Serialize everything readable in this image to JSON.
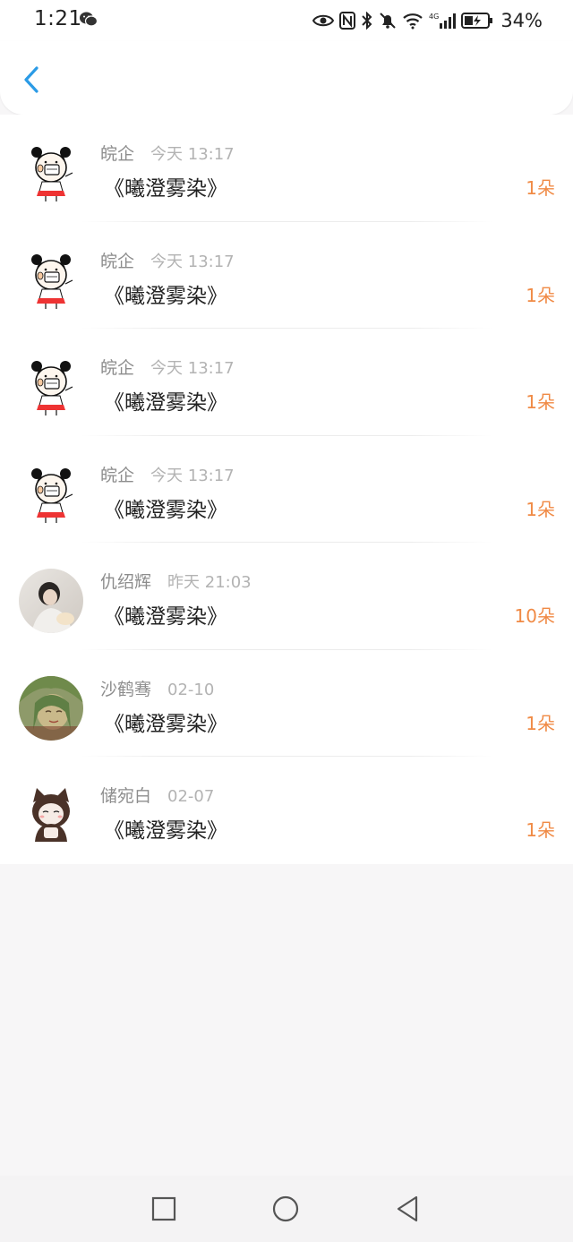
{
  "status_bar": {
    "time": "1:21",
    "battery_percent": "34%",
    "icons": [
      "wechat-icon",
      "eye-icon",
      "nfc-icon",
      "bluetooth-icon",
      "bell-muted-icon",
      "wifi-icon",
      "signal-4g-icon",
      "battery-charging-icon"
    ]
  },
  "header": {
    "back_icon": "chevron-left-icon",
    "accent_color": "#2b9be6"
  },
  "list": {
    "items": [
      {
        "name": "皖企",
        "time": "今天 13:17",
        "title": "《曦澄雾染》",
        "amount": "1朵",
        "avatar": "cartoon-girl"
      },
      {
        "name": "皖企",
        "time": "今天 13:17",
        "title": "《曦澄雾染》",
        "amount": "1朵",
        "avatar": "cartoon-girl"
      },
      {
        "name": "皖企",
        "time": "今天 13:17",
        "title": "《曦澄雾染》",
        "amount": "1朵",
        "avatar": "cartoon-girl"
      },
      {
        "name": "皖企",
        "time": "今天 13:17",
        "title": "《曦澄雾染》",
        "amount": "1朵",
        "avatar": "cartoon-girl"
      },
      {
        "name": "仇绍辉",
        "time": "昨天 21:03",
        "title": "《曦澄雾染》",
        "amount": "10朵",
        "avatar": "photo-person"
      },
      {
        "name": "沙鹤骞",
        "time": "02-10",
        "title": "《曦澄雾染》",
        "amount": "1朵",
        "avatar": "green-anime"
      },
      {
        "name": "储宛白",
        "time": "02-07",
        "title": "《曦澄雾染》",
        "amount": "1朵",
        "avatar": "cat-ear-cartoon"
      }
    ],
    "amount_color": "#f08a45"
  },
  "nav_bar": {
    "buttons": [
      "recent-apps",
      "home",
      "back"
    ]
  }
}
